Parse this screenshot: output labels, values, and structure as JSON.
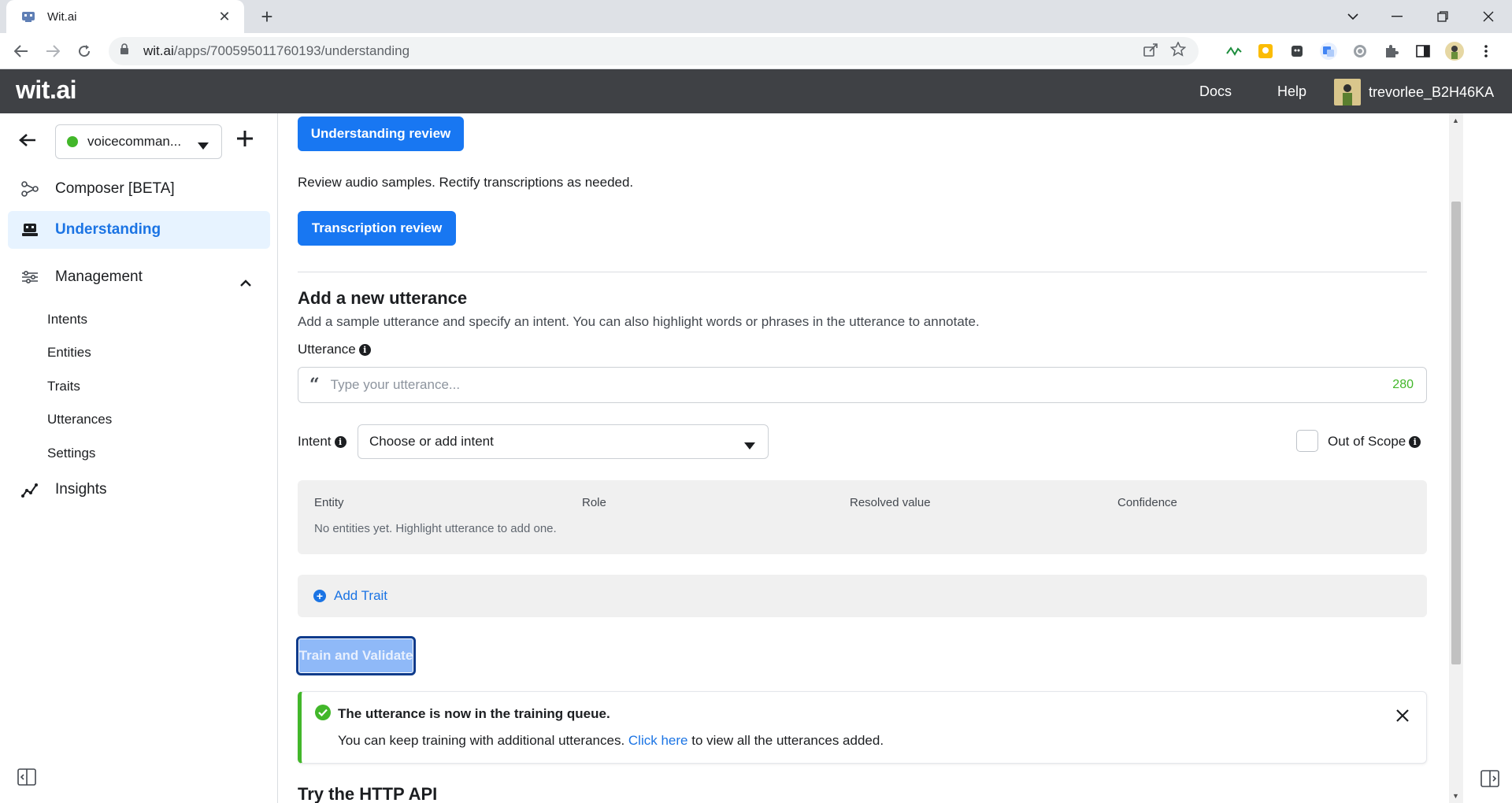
{
  "browser": {
    "tab_title": "Wit.ai",
    "tab_close": "✕",
    "new_tab": "+",
    "url_host": "wit.ai",
    "url_path": "/apps/700595011760193/understanding"
  },
  "header": {
    "logo": "wit.ai",
    "docs": "Docs",
    "help": "Help",
    "username": "trevorlee_B2H46KA"
  },
  "sidebar": {
    "app_name": "voicecomman...",
    "app_status_color": "#42b72a",
    "items": [
      {
        "label": "Composer [BETA]",
        "icon": "composer-icon"
      },
      {
        "label": "Understanding",
        "icon": "understanding-icon",
        "active": true
      },
      {
        "label": "Management",
        "icon": "management-icon"
      },
      {
        "label": "Insights",
        "icon": "insights-icon"
      }
    ],
    "management_sub": [
      "Intents",
      "Entities",
      "Traits",
      "Utterances",
      "Settings"
    ]
  },
  "main": {
    "understanding_review_btn": "Understanding review",
    "review_desc": "Review audio samples. Rectify transcriptions as needed.",
    "transcription_review_btn": "Transcription review",
    "add_title": "Add a new utterance",
    "add_desc": "Add a sample utterance and specify an intent. You can also highlight words or phrases in the utterance to annotate.",
    "utterance_label": "Utterance",
    "utterance_placeholder": "Type your utterance...",
    "char_count": "280",
    "intent_label": "Intent",
    "intent_value": "Choose or add intent",
    "out_of_scope": "Out of Scope",
    "table_headers": [
      "Entity",
      "Role",
      "Resolved value",
      "Confidence"
    ],
    "empty_entities": "No entities yet. Highlight utterance to add one.",
    "add_trait": "Add Trait",
    "train_btn": "Train and Validate",
    "toast_title": "The utterance is now in the training queue.",
    "toast_pre": "You can keep training with additional utterances. ",
    "toast_link": "Click here",
    "toast_post": " to view all the utterances added.",
    "api_title": "Try the HTTP API"
  },
  "colors": {
    "primary": "#1877f2",
    "success": "#42b72a",
    "header_bg": "#3f4145"
  }
}
